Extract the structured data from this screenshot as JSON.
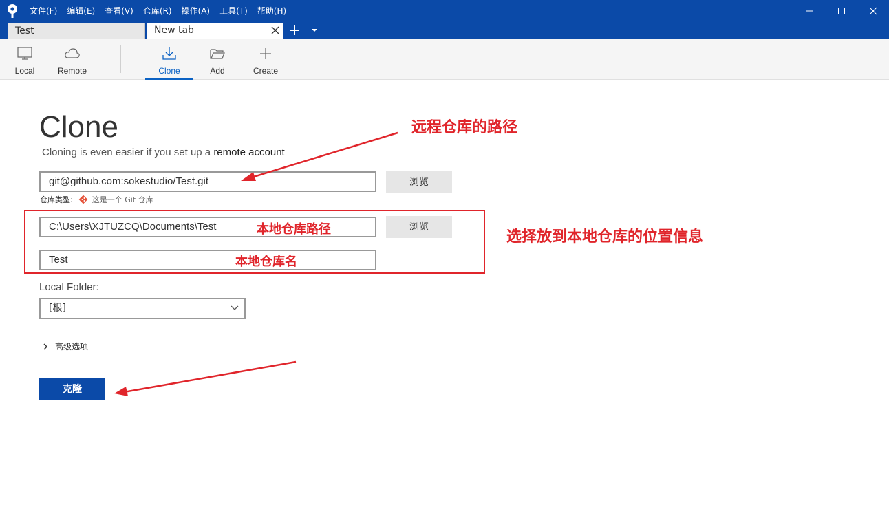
{
  "menu": {
    "items": [
      "文件(F)",
      "编辑(E)",
      "查看(V)",
      "仓库(R)",
      "操作(A)",
      "工具(T)",
      "帮助(H)"
    ]
  },
  "tabs": {
    "items": [
      "Test",
      "New tab"
    ]
  },
  "toolbar": {
    "local": "Local",
    "remote": "Remote",
    "clone": "Clone",
    "add": "Add",
    "create": "Create"
  },
  "main": {
    "title": "Clone",
    "subtitle_prefix": "Cloning is even easier if you set up a ",
    "subtitle_link": "remote account",
    "source_url": "git@github.com:sokestudio/Test.git",
    "browse_label": "浏览",
    "repo_type_label": "仓库类型:",
    "repo_type_value": "这是一个 Git 仓库",
    "destination_path": "C:\\Users\\XJTUZCQ\\Documents\\Test",
    "name": "Test",
    "local_folder_label": "Local Folder:",
    "local_folder_value": "[根]",
    "advanced_label": "高级选项",
    "clone_button": "克隆"
  },
  "annotations": {
    "remote_path": "远程仓库的路径",
    "local_path": "本地仓库路径",
    "local_name": "本地仓库名",
    "select_location": "选择放到本地仓库的位置信息",
    "color": "#e0252b"
  },
  "colors": {
    "titlebar": "#0b4aa8",
    "accent": "#0b62c4"
  }
}
